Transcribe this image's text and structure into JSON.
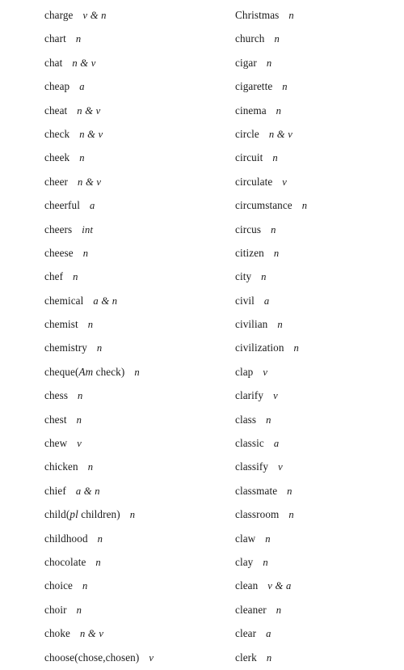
{
  "page": {
    "title": "English vocabulary list — ch / ci / cl",
    "background_color": "#ffffff",
    "text_color": "#1a1a1a",
    "columns": 2,
    "rows_per_column": 28
  },
  "columns": [
    {
      "name": "left-column",
      "entries": [
        {
          "headword": "charge",
          "pos": "v & n"
        },
        {
          "headword": "chart",
          "pos": "n"
        },
        {
          "headword": "chat",
          "pos": "n & v"
        },
        {
          "headword": "cheap",
          "pos": "a"
        },
        {
          "headword": "cheat",
          "pos": "n & v"
        },
        {
          "headword": "check",
          "pos": "n & v"
        },
        {
          "headword": "cheek",
          "pos": "n"
        },
        {
          "headword": "cheer",
          "pos": "n & v"
        },
        {
          "headword": "cheerful",
          "pos": "a"
        },
        {
          "headword": "cheers",
          "pos": "int"
        },
        {
          "headword": "cheese",
          "pos": "n"
        },
        {
          "headword": "chef",
          "pos": "n"
        },
        {
          "headword": "chemical",
          "pos": "a & n"
        },
        {
          "headword": "chemist",
          "pos": "n"
        },
        {
          "headword": "chemistry",
          "pos": "n"
        },
        {
          "headword": "cheque(",
          "headword_italic": "Am",
          "headword_tail": " check)",
          "pos": "n"
        },
        {
          "headword": "chess",
          "pos": "n"
        },
        {
          "headword": "chest",
          "pos": "n"
        },
        {
          "headword": "chew",
          "pos": "v"
        },
        {
          "headword": "chicken",
          "pos": "n"
        },
        {
          "headword": "chief",
          "pos": "a & n"
        },
        {
          "headword": "child(",
          "headword_italic": "pl",
          "headword_tail": " children)",
          "pos": "n"
        },
        {
          "headword": "childhood",
          "pos": "n"
        },
        {
          "headword": "chocolate",
          "pos": "n"
        },
        {
          "headword": "choice",
          "pos": "n"
        },
        {
          "headword": "choir",
          "pos": "n"
        },
        {
          "headword": "choke",
          "pos": "n & v"
        },
        {
          "headword": "choose(chose,chosen)",
          "pos": "v"
        }
      ]
    },
    {
      "name": "right-column",
      "entries": [
        {
          "headword": "Christmas",
          "pos": "n"
        },
        {
          "headword": "church",
          "pos": "n"
        },
        {
          "headword": "cigar",
          "pos": "n"
        },
        {
          "headword": "cigarette",
          "pos": "n"
        },
        {
          "headword": "cinema",
          "pos": "n"
        },
        {
          "headword": "circle",
          "pos": "n & v"
        },
        {
          "headword": "circuit",
          "pos": "n"
        },
        {
          "headword": "circulate",
          "pos": "v"
        },
        {
          "headword": "circumstance",
          "pos": "n"
        },
        {
          "headword": "circus",
          "pos": "n"
        },
        {
          "headword": "citizen",
          "pos": "n"
        },
        {
          "headword": "city",
          "pos": "n"
        },
        {
          "headword": "civil",
          "pos": "a"
        },
        {
          "headword": "civilian",
          "pos": "n"
        },
        {
          "headword": "civilization",
          "pos": "n"
        },
        {
          "headword": "clap",
          "pos": "v"
        },
        {
          "headword": "clarify",
          "pos": "v"
        },
        {
          "headword": "class",
          "pos": "n"
        },
        {
          "headword": "classic",
          "pos": "a"
        },
        {
          "headword": "classify",
          "pos": "v"
        },
        {
          "headword": "classmate",
          "pos": "n"
        },
        {
          "headword": "classroom",
          "pos": "n"
        },
        {
          "headword": "claw",
          "pos": "n"
        },
        {
          "headword": "clay",
          "pos": "n"
        },
        {
          "headword": "clean",
          "pos": "v & a"
        },
        {
          "headword": "cleaner",
          "pos": "n"
        },
        {
          "headword": "clear",
          "pos": "a"
        },
        {
          "headword": "clerk",
          "pos": "n"
        }
      ]
    }
  ]
}
